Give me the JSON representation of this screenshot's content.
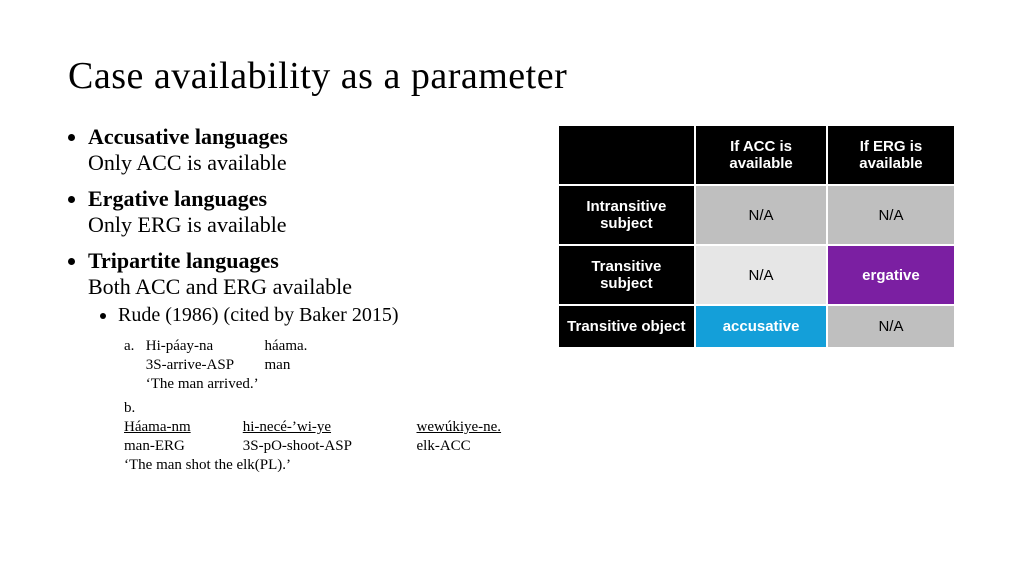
{
  "title": "Case availability as a parameter",
  "bullets": {
    "accusative": {
      "head": "Accusative languages",
      "body": "Only ACC is available"
    },
    "ergative": {
      "head": "Ergative languages",
      "body": "Only ERG is available"
    },
    "tripartite": {
      "head": "Tripartite languages",
      "body": "Both ACC and ERG available",
      "sub": "Rude (1986) (cited by Baker 2015)"
    }
  },
  "examples": {
    "a": {
      "label": "a.",
      "words": [
        "Hi-páay-na",
        "háama."
      ],
      "gloss": [
        "3S-arrive-ASP",
        "man"
      ],
      "translation": "‘The man arrived.’"
    },
    "b": {
      "label": "b.",
      "words": [
        "Háama-nm",
        "hi-necé-’wi-ye",
        "wewúkiye-ne."
      ],
      "gloss": [
        "man-ERG",
        "3S-pO-shoot-ASP",
        "elk-ACC"
      ],
      "translation": "‘The man shot the elk(PL).’"
    }
  },
  "table": {
    "headers": {
      "col1": "If ACC is available",
      "col2": "If ERG is available"
    },
    "rows": {
      "intrans": {
        "label": "Intransitive subject",
        "c1": "N/A",
        "c2": "N/A"
      },
      "transS": {
        "label": "Transitive subject",
        "c1": "N/A",
        "c2": "ergative"
      },
      "transO": {
        "label": "Transitive object",
        "c1": "accusative",
        "c2": "N/A"
      }
    }
  }
}
